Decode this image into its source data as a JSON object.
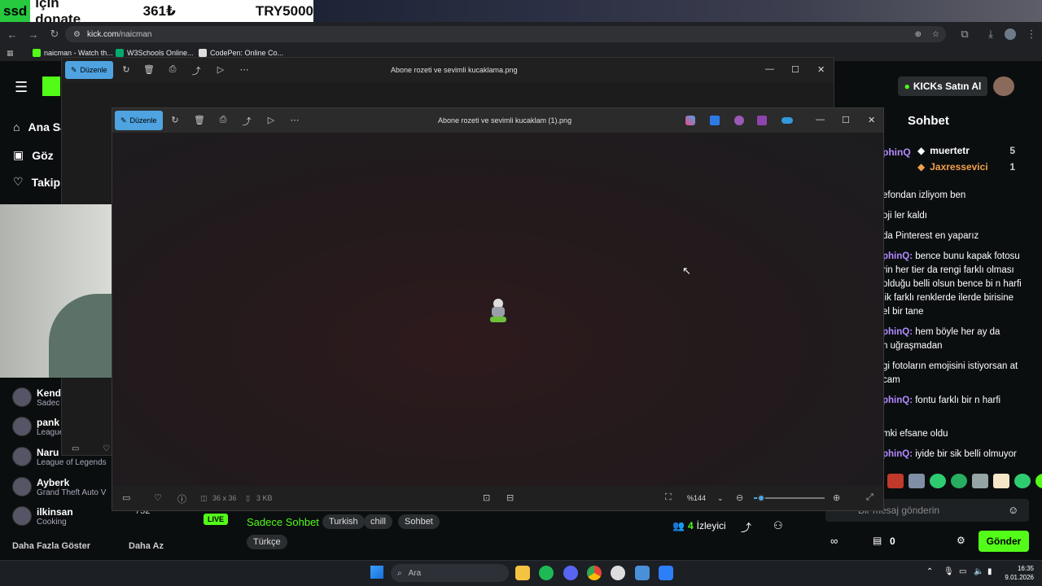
{
  "donation": {
    "prefix": "ssd",
    "text": "için donate",
    "amount_try_symbol": "361₺",
    "goal": "TRY5000"
  },
  "browser": {
    "url_host": "kick.com",
    "url_path": "/naicman",
    "bookmarks": [
      "naicman - Watch th...",
      "W3Schools Online...",
      "CodePen: Online Co..."
    ]
  },
  "kick": {
    "nav": [
      "Ana Sayfa",
      "Göz",
      "Takip"
    ],
    "buy_kicks": "KICKs Satın Al",
    "chat_title": "Sohbet",
    "leaderboard": [
      {
        "name": "muertetr",
        "count": "5"
      },
      {
        "name": "Jaxressevici",
        "count": "1"
      }
    ],
    "chat_partial_user": "phinQ",
    "chat_lines": [
      {
        "user": "",
        "text": "efondan izliyom ben"
      },
      {
        "user": "",
        "text": "oji ler kaldı"
      },
      {
        "user": "",
        "text": "da Pinterest en yaparız"
      },
      {
        "user": "phinQ:",
        "text": " bence bunu kapak fotosu"
      },
      {
        "user": "",
        "text": "rin her tier da rengi farklı olması"
      },
      {
        "user": "",
        "text": "olduğu belli olsun bence bi n harfi"
      },
      {
        "user": "",
        "text": "lik farklı renklerde ilerde birisine"
      },
      {
        "user": "",
        "text": "el bir tane"
      },
      {
        "user": "phinQ:",
        "text": " hem böyle her ay da"
      },
      {
        "user": "",
        "text": "n uğraşmadan"
      },
      {
        "user": "",
        "text": "gi fotoların emojisini istiyorsan at"
      },
      {
        "user": "",
        "text": "cam"
      },
      {
        "user": "phinQ:",
        "text": " fontu farklı bir n harfi"
      },
      {
        "user": "",
        "text": "mki efsane oldu"
      },
      {
        "user": "phinQ:",
        "text": " iyide bir sik belli olmuyor"
      }
    ],
    "chat_placeholder": "Bir mesaj gönderin",
    "send_label": "Gönder",
    "kick_count": "0",
    "suggested": [
      {
        "name": "Kend",
        "sub": "Sadec"
      },
      {
        "name": "pank",
        "sub": "League"
      },
      {
        "name": "Naru",
        "sub": "League of Legends"
      },
      {
        "name": "Ayberk",
        "sub": "Grand Theft Auto V"
      },
      {
        "name": "ilkinsan",
        "sub": "Cooking"
      }
    ],
    "viewer_partial": "752",
    "show_more": "Daha Fazla Göster",
    "show_less": "Daha Az",
    "live_badge": "LIVE",
    "stream_category": "Sadece Sohbet",
    "tags": [
      "Turkish",
      "chill",
      "Sohbet",
      "Türkçe"
    ],
    "viewers": "4",
    "viewers_label": "İzleyici"
  },
  "photos_back": {
    "title": "Abone rozeti ve sevimli kucaklama.png",
    "edit_label": "Düzenle"
  },
  "photos_front": {
    "title": "Abone rozeti ve sevimli kucaklam (1).png",
    "edit_label": "Düzenle",
    "dimensions": "36 x 36",
    "size": "3 KB",
    "zoom": "%144",
    "zoom_level": 0.1
  },
  "taskbar": {
    "search_label": "Ara",
    "time": "16:35",
    "date": "9.01.2026"
  },
  "colors": {
    "kick_green": "#53fc18",
    "photos_accent": "#4fa3e0",
    "chat_user": "#b38bff"
  }
}
